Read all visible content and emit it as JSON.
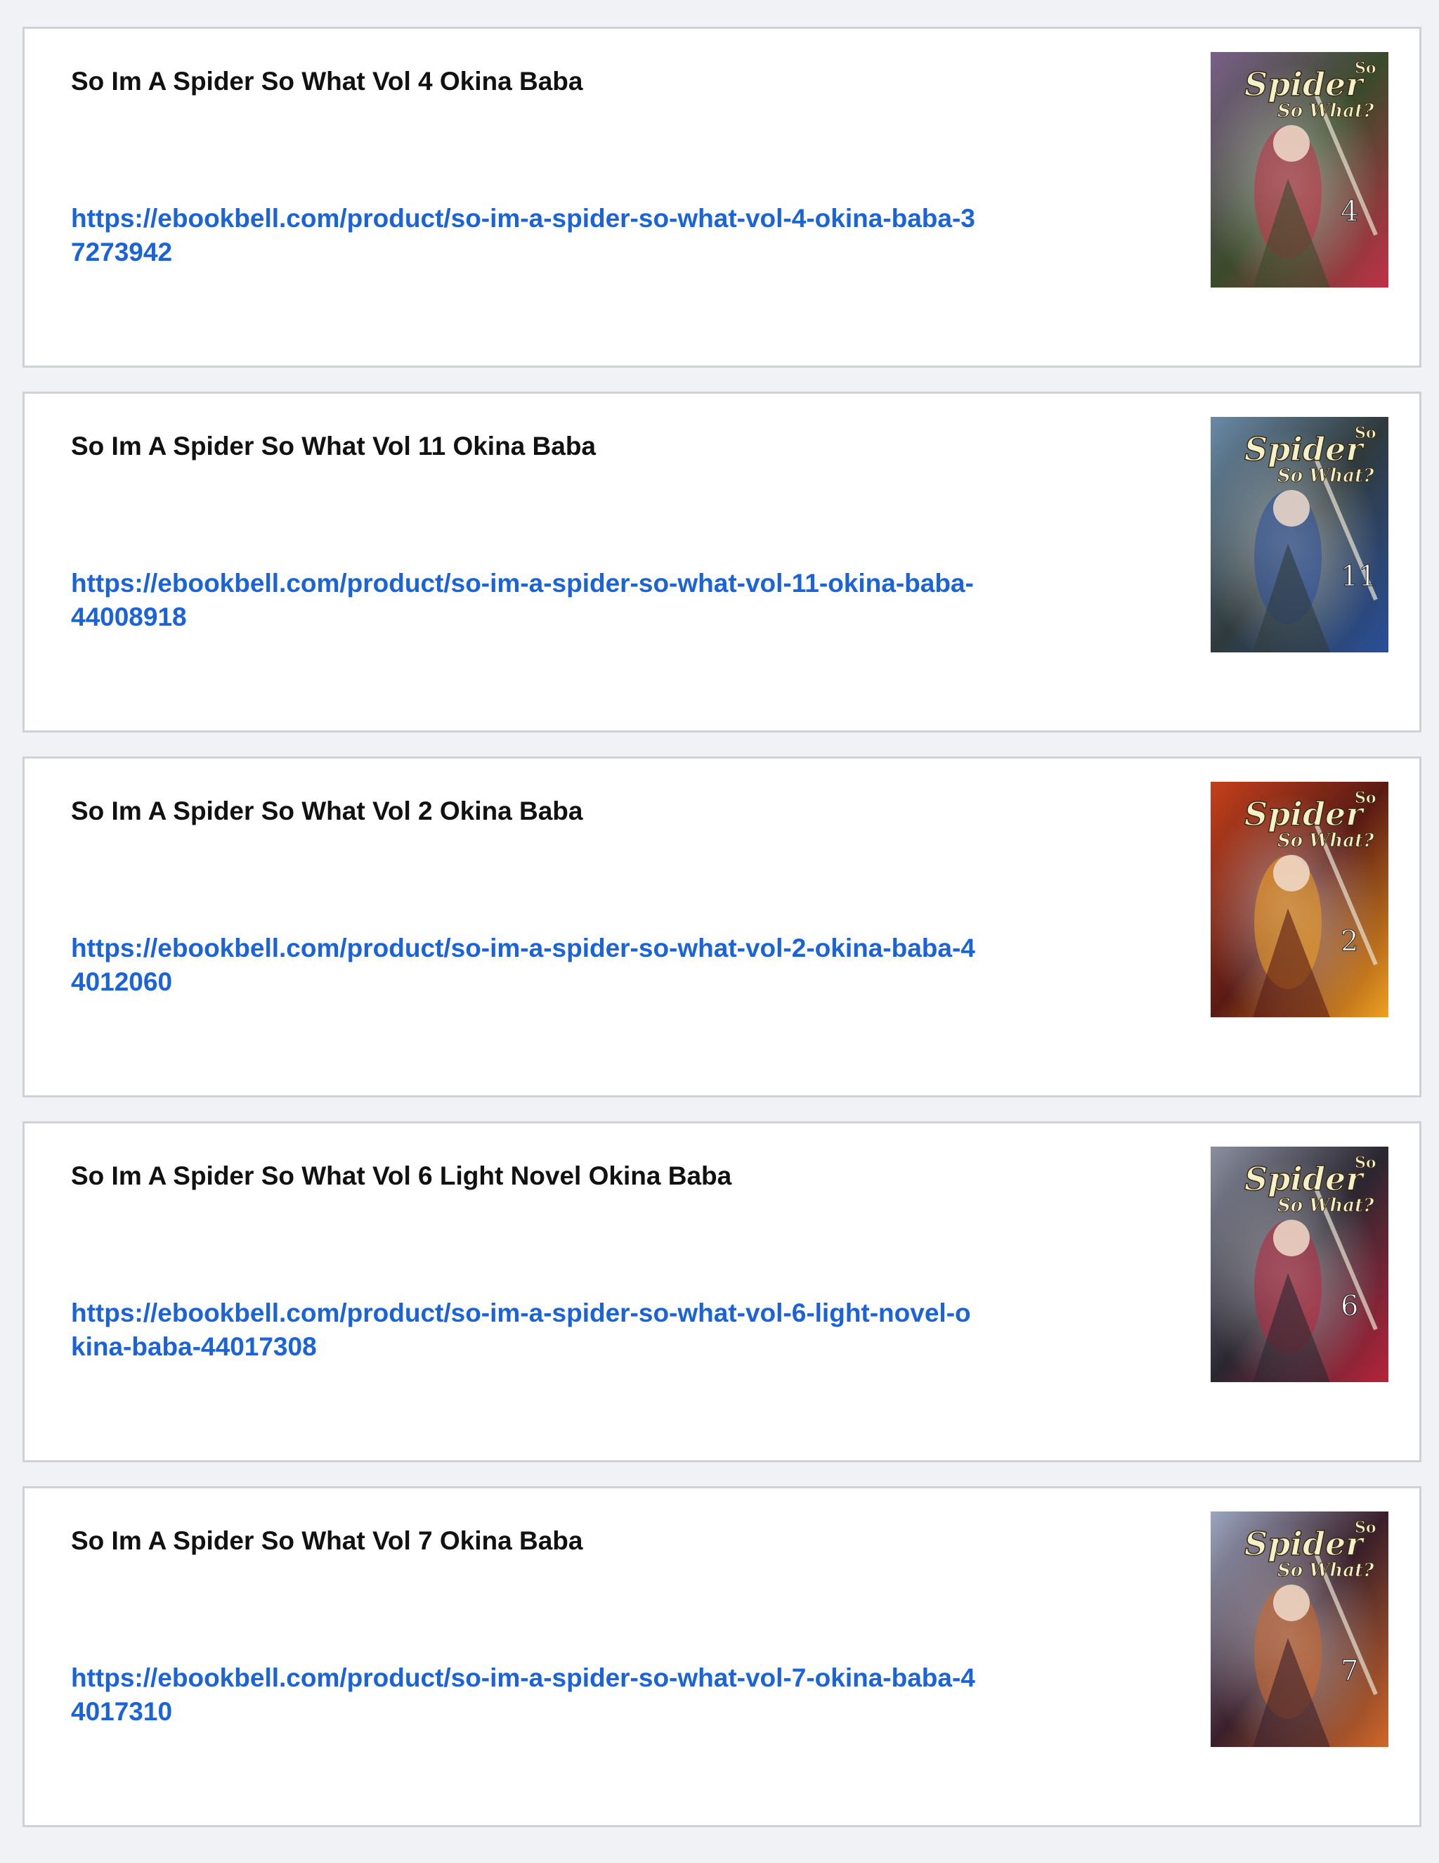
{
  "results": [
    {
      "title": "So Im A Spider So What Vol 4 Okina Baba",
      "url": "https://ebookbell.com/product/so-im-a-spider-so-what-vol-4-okina-baba-37273942",
      "cover_volume": "4",
      "cover_colors": [
        "#3a4a2a",
        "#7a5f8a",
        "#c23046"
      ]
    },
    {
      "title": "So Im A Spider So What Vol 11 Okina Baba",
      "url": "https://ebookbell.com/product/so-im-a-spider-so-what-vol-11-okina-baba-44008918",
      "cover_volume": "11",
      "cover_colors": [
        "#2f3a3c",
        "#6a8aa6",
        "#2a4f9a"
      ]
    },
    {
      "title": "So Im A Spider So What Vol 2 Okina Baba",
      "url": "https://ebookbell.com/product/so-im-a-spider-so-what-vol-2-okina-baba-44012060",
      "cover_volume": "2",
      "cover_colors": [
        "#5a1a14",
        "#c4401c",
        "#f0a020"
      ]
    },
    {
      "title": "So Im A Spider So What Vol 6 Light Novel Okina Baba",
      "url": "https://ebookbell.com/product/so-im-a-spider-so-what-vol-6-light-novel-okina-baba-44017308",
      "cover_volume": "6",
      "cover_colors": [
        "#2a2630",
        "#8a8fa0",
        "#b8243a"
      ]
    },
    {
      "title": "So Im A Spider So What Vol 7 Okina Baba",
      "url": "https://ebookbell.com/product/so-im-a-spider-so-what-vol-7-okina-baba-44017310",
      "cover_volume": "7",
      "cover_colors": [
        "#3a1f2a",
        "#9aa6c0",
        "#d0682a"
      ]
    }
  ]
}
